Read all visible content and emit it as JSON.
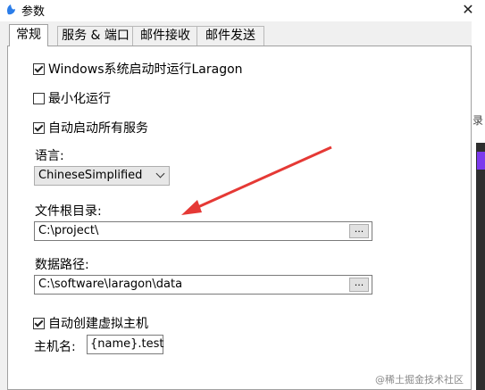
{
  "window": {
    "title": "参数",
    "close_glyph": "✕"
  },
  "tabs": [
    {
      "label": "常规",
      "active": true
    },
    {
      "label": "服务 & 端口",
      "active": false
    },
    {
      "label": "邮件接收",
      "active": false
    },
    {
      "label": "邮件发送",
      "active": false
    }
  ],
  "general": {
    "autostart_label": "Windows系统启动时运行Laragon",
    "minimized_label": "最小化运行",
    "start_all_label": "自动启动所有服务",
    "language_label": "语言:",
    "language_value": "ChineseSimplified",
    "doc_root_label": "文件根目录:",
    "doc_root_value": "C:\\project\\",
    "data_path_label": "数据路径:",
    "data_path_value": "C:\\software\\laragon\\data",
    "browse_label": "...",
    "auto_vhost_label": "自动创建虚拟主机",
    "hostname_label": "主机名:",
    "hostname_value": "{name}.test"
  },
  "checkbox_states": {
    "autostart": true,
    "minimized": false,
    "start_all": true,
    "auto_vhost": true
  },
  "background": {
    "right_text": "录"
  },
  "watermark": "@稀土掘金技术社区",
  "colors": {
    "arrow": "#e53935",
    "app_icon": "#2b7de9"
  },
  "icons": [
    "app-icon",
    "close-icon",
    "chevron-down-icon",
    "checkbox-icon",
    "annotation-arrow-icon"
  ]
}
